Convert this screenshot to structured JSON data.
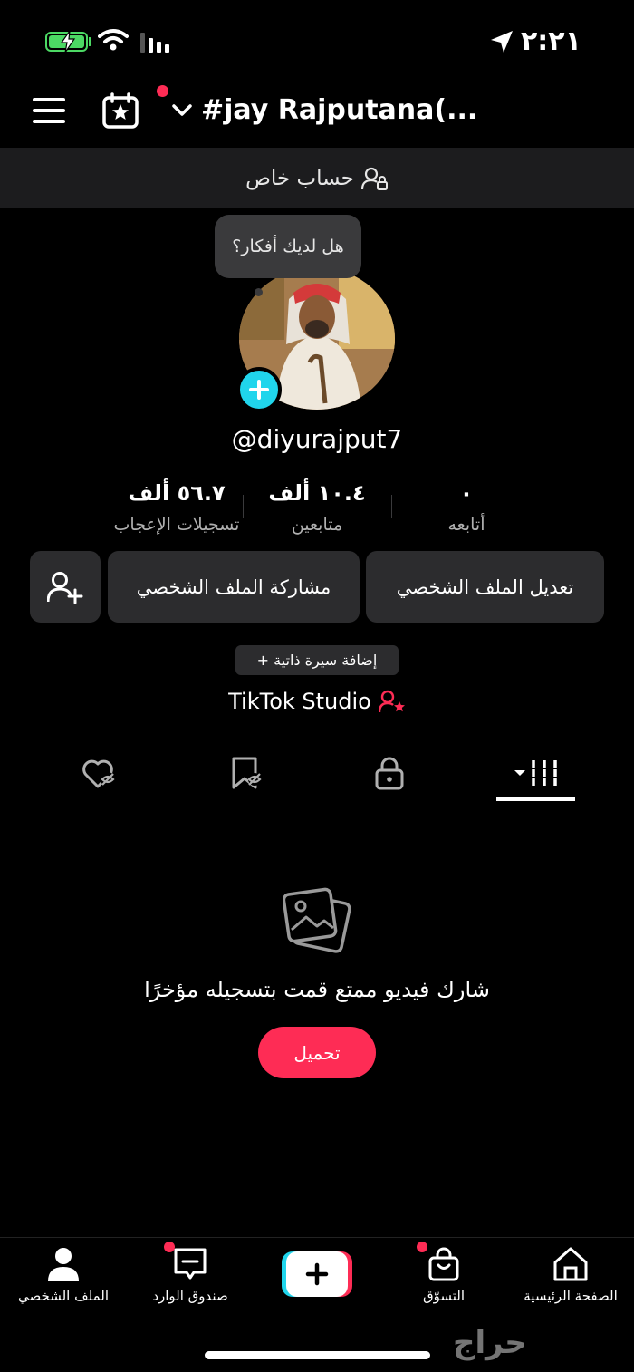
{
  "status_bar": {
    "time": "٢:٢١"
  },
  "header": {
    "account_name": "#jay Rajputana(..."
  },
  "private_banner": {
    "label": "حساب خاص"
  },
  "profile": {
    "thought_bubble": "هل لديك أفكار؟",
    "username": "@diyurajput7"
  },
  "stats": [
    {
      "value": "٥٦.٧ ألف",
      "label": "تسجيلات الإعجاب"
    },
    {
      "value": "١٠.٤ ألف",
      "label": "متابعين"
    },
    {
      "value": "٠",
      "label": "أتابعه"
    }
  ],
  "actions": {
    "edit_profile": "تعديل الملف الشخصي",
    "share_profile": "مشاركة الملف الشخصي"
  },
  "add_bio": "+ إضافة سيرة ذاتية",
  "studio_link": "TikTok Studio",
  "empty_state": {
    "message": "شارك فيديو ممتع قمت بتسجيله مؤخرًا",
    "upload_label": "تحميل"
  },
  "bottom_nav": {
    "profile": "الملف الشخصي",
    "inbox": "صندوق الوارد",
    "shop": "التسوّق",
    "home": "الصفحة الرئيسية"
  },
  "watermark": "حراج",
  "colors": {
    "accent": "#fe2c55",
    "cyan": "#20d5ec",
    "surface": "#2c2c2e"
  }
}
